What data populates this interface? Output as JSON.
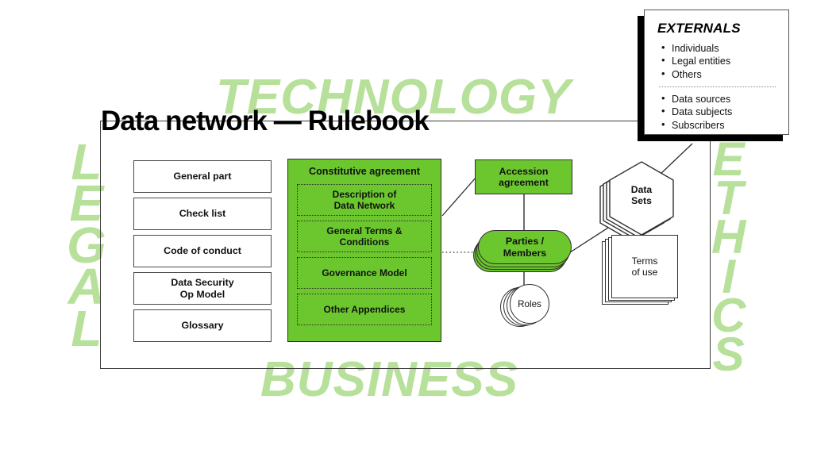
{
  "page": {
    "title": "Data network — Rulebook",
    "background_color": "#ffffff",
    "accent_green": "#6cc62e",
    "watermark_green": "#b7e09a",
    "line_color": "#2f2f2f"
  },
  "watermarks": {
    "technology": "TECHNOLOGY",
    "business": "BUSINESS",
    "legal": [
      "L",
      "E",
      "G",
      "A",
      "L"
    ],
    "ethics": [
      "E",
      "T",
      "H",
      "I",
      "C",
      "S"
    ]
  },
  "left_column": {
    "items": [
      {
        "label": "General part"
      },
      {
        "label": "Check list"
      },
      {
        "label": "Code of conduct"
      },
      {
        "label_line1": "Data Security",
        "label_line2": "Op Model"
      },
      {
        "label": "Glossary"
      }
    ]
  },
  "constitutive": {
    "title": "Constitutive agreement",
    "appendices": [
      {
        "line1": "Description of",
        "line2": "Data Network"
      },
      {
        "line1": "General Terms &",
        "line2": "Conditions"
      },
      {
        "line1": "Governance Model",
        "line2": ""
      },
      {
        "line1": "Other Appendices",
        "line2": ""
      }
    ]
  },
  "accession": {
    "line1": "Accession",
    "line2": "agreement"
  },
  "parties": {
    "line1": "Parties /",
    "line2": "Members"
  },
  "roles": {
    "label": "Roles"
  },
  "datasets": {
    "line1": "Data",
    "line2": "Sets"
  },
  "terms": {
    "line1": "Terms",
    "line2": "of use"
  },
  "externals": {
    "title": "EXTERNALS",
    "group_one": [
      "Individuals",
      "Legal entities",
      "Others"
    ],
    "group_two": [
      "Data sources",
      "Data subjects",
      "Subscribers"
    ]
  }
}
